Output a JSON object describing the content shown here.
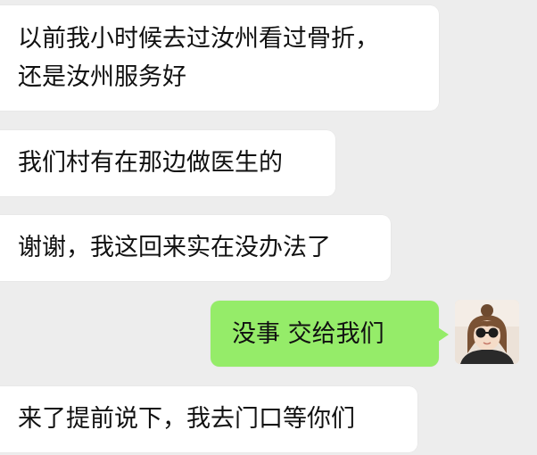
{
  "chat": {
    "messages": [
      {
        "side": "incoming",
        "lines": [
          "以前我小时候去过汝州看过骨折，",
          "还是汝州服务好"
        ]
      },
      {
        "side": "incoming",
        "lines": [
          "我们村有在那边做医生的"
        ]
      },
      {
        "side": "incoming",
        "lines": [
          "谢谢，我这回来实在没办法了"
        ]
      },
      {
        "side": "outgoing",
        "lines": [
          "没事 交给我们"
        ]
      },
      {
        "side": "incoming",
        "lines": [
          "来了提前说下，我去门口等你们"
        ]
      }
    ],
    "avatar_icon": "user-avatar-photo",
    "colors": {
      "background": "#ededed",
      "incoming_bubble": "#ffffff",
      "outgoing_bubble": "#95ec69",
      "text": "#111111"
    }
  }
}
